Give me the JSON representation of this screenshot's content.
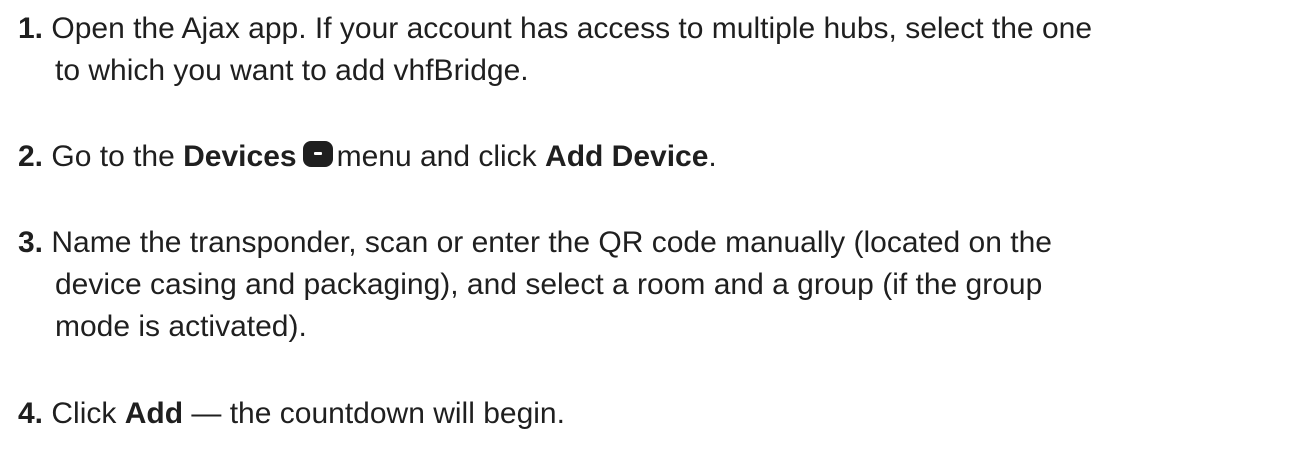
{
  "steps": [
    {
      "number": "1.",
      "line1": "Open the Ajax app. If your account has access to multiple hubs, select the one",
      "line2": "to which you want to add vhfBridge."
    },
    {
      "number": "2.",
      "prefix": "Go to the",
      "menu_name": "Devices",
      "icon": "devices-icon",
      "middle": "menu and click",
      "action": "Add Device",
      "suffix": "."
    },
    {
      "number": "3.",
      "line1": "Name the transponder, scan or enter the QR code manually (located on the",
      "line2": "device casing and packaging), and select a room and a group (if the group",
      "line3": "mode is activated)."
    },
    {
      "number": "4.",
      "prefix": "Click",
      "action": "Add",
      "suffix": "— the countdown will begin."
    }
  ]
}
